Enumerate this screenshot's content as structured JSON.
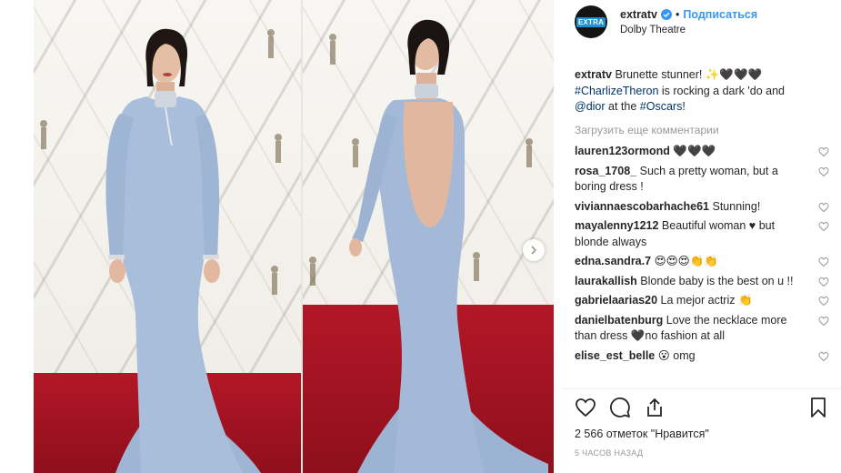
{
  "post": {
    "username": "extratv",
    "avatar_label": "EXTRA",
    "follow_separator": "•",
    "follow_label": "Подписаться",
    "location": "Dolby Theatre"
  },
  "caption": {
    "username": "extratv",
    "text1": " Brunette stunner! ✨🖤🖤🖤",
    "hashtag_charlize": "#CharlizeTheron",
    "text2": " is rocking a dark 'do and ",
    "mention_dior": "@dior",
    "text3": " at the ",
    "hashtag_oscars": "#Oscars",
    "text4": "!"
  },
  "load_more": "Загрузить еще комментарии",
  "comments": [
    {
      "user": "lauren123ormond",
      "text": "🖤🖤🖤"
    },
    {
      "user": "rosa_1708_",
      "text": "Such a pretty woman, but a boring dress !"
    },
    {
      "user": "viviannaescobarhache61",
      "text": "Stunning!"
    },
    {
      "user": "mayalenny1212",
      "text": "Beautiful woman ♥ but blonde always"
    },
    {
      "user": "edna.sandra.7",
      "text": "😍😍😍👏👏"
    },
    {
      "user": "laurakallish",
      "text": "Blonde baby is the best on u !!"
    },
    {
      "user": "gabrielaarias20",
      "text": "La mejor actriz 👏"
    },
    {
      "user": "danielbatenburg",
      "text": "Love the necklace more than dress 🖤no fashion at all"
    },
    {
      "user": "elise_est_belle",
      "text": "😮 omg"
    }
  ],
  "likes": "2 566 отметок \"Нравится\"",
  "timestamp": "5 ЧАСОВ НАЗАД",
  "icons": {
    "verified": "verified-badge-icon",
    "like": "heart-icon",
    "comment": "speech-bubble-icon",
    "share": "share-icon",
    "save": "bookmark-icon",
    "next": "chevron-right-icon"
  },
  "colors": {
    "link": "#3897f0",
    "hashtag": "#003569",
    "muted": "#999999",
    "carpet": "#b31727",
    "dress": "#a7bcd9"
  }
}
